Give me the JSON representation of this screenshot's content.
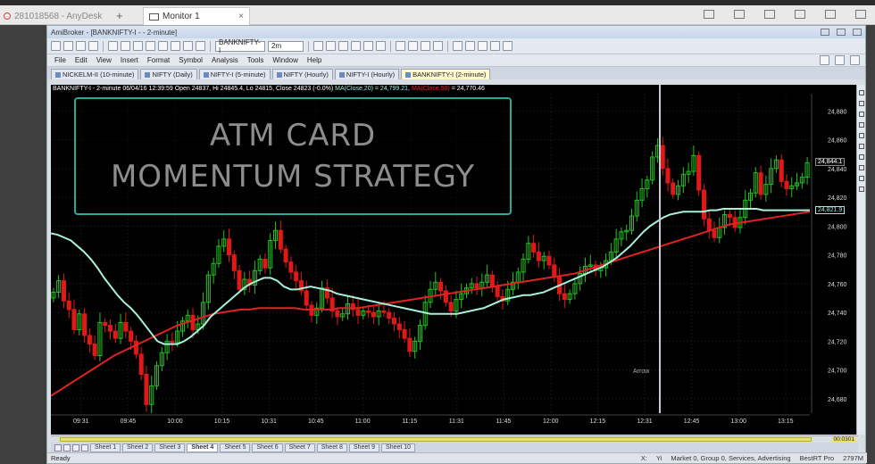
{
  "anydesk": {
    "session_tab": "281018568 - AnyDesk",
    "new_tab_symbol": "+",
    "monitor_tab": "Monitor 1",
    "close_symbol": "×"
  },
  "window": {
    "title": "AmiBroker - [BANKNIFTY-I - - 2-minute]"
  },
  "toolbar": {
    "symbol_combo": "BANKNIFTY-I",
    "interval_combo": "2m"
  },
  "menu": [
    "File",
    "Edit",
    "View",
    "Insert",
    "Format",
    "Symbol",
    "Analysis",
    "Tools",
    "Window",
    "Help"
  ],
  "chart_tabs": [
    {
      "label": "NICKELM-II (10-minute)",
      "active": false
    },
    {
      "label": "NIFTY (Daily)",
      "active": false
    },
    {
      "label": "NIFTY-I (5-minute)",
      "active": false
    },
    {
      "label": "NIFTY (Hourly)",
      "active": false
    },
    {
      "label": "NIFTY-I (Hourly)",
      "active": false
    },
    {
      "label": "BANKNIFTY-I (2-minute)",
      "active": true
    }
  ],
  "chart_header": {
    "main": "BANKNIFTY-I - 2-minute 06/04/16 12:39:59 Open 24837, Hi 24845.4, Lo 24815, Close 24823 (-0.0%)",
    "ma1": "MA(Close,20) = 24,799.21,",
    "ma2": "MA(Close,50)",
    "ma2_value": "= 24,770.46"
  },
  "overlay": {
    "line1": "ATM CARD",
    "line2": "MOMENTUM STRATEGY"
  },
  "price_tags": {
    "last": "24,844.1",
    "ma": "24,821.9"
  },
  "cursor_label": "Arrow",
  "chart_data": {
    "type": "candlestick",
    "title": "",
    "x_ticks": [
      "09:31",
      "09:45",
      "10:00",
      "10:15",
      "10:31",
      "10:45",
      "11:00",
      "11:15",
      "11:31",
      "11:45",
      "12:00",
      "12:15",
      "12:31",
      "12:45",
      "13:00",
      "13:15"
    ],
    "y_ticks": [
      24680,
      24700,
      24720,
      24740,
      24760,
      24780,
      24800,
      24820,
      24840,
      24860,
      24880
    ],
    "ylim": [
      24670,
      24892
    ],
    "grid": true,
    "colors": {
      "up": "#21c421",
      "down": "#e01818",
      "ma20": "#a8f0dc",
      "ma50": "#e02222",
      "background": "#000000"
    },
    "close": [
      24754,
      24762,
      24748,
      24742,
      24728,
      24739,
      24724,
      24718,
      24710,
      24733,
      24731,
      24727,
      24722,
      24733,
      24727,
      24720,
      24711,
      24697,
      24676,
      24689,
      24703,
      24712,
      24720,
      24719,
      24727,
      24734,
      24738,
      24728,
      24732,
      24747,
      24766,
      24774,
      24786,
      24791,
      24780,
      24769,
      24756,
      24763,
      24759,
      24769,
      24777,
      24771,
      24790,
      24797,
      24784,
      24775,
      24768,
      24762,
      24755,
      24745,
      24738,
      24743,
      24757,
      24750,
      24741,
      24737,
      24739,
      24746,
      24742,
      24738,
      24741,
      24740,
      24737,
      24741,
      24740,
      24736,
      24732,
      24728,
      24722,
      24713,
      24720,
      24731,
      24747,
      24756,
      24761,
      24755,
      24747,
      24741,
      24749,
      24753,
      24757,
      24760,
      24757,
      24761,
      24766,
      24758,
      24751,
      24748,
      24756,
      24761,
      24768,
      24777,
      24788,
      24782,
      24776,
      24779,
      24773,
      24765,
      24753,
      24749,
      24753,
      24760,
      24767,
      24772,
      24773,
      24769,
      24771,
      24776,
      24782,
      24791,
      24796,
      24797,
      24807,
      24818,
      24826,
      24832,
      24848,
      24856,
      24840,
      24830,
      24822,
      24828,
      24836,
      24838,
      24849,
      24825,
      24805,
      24797,
      24792,
      24799,
      24808,
      24806,
      24799,
      24806,
      24818,
      24823,
      24837,
      24822,
      24829,
      24840,
      24846,
      24831,
      24826,
      24828,
      24830,
      24834,
      24844
    ],
    "ma20": [
      24795,
      24794,
      24792,
      24790,
      24786,
      24782,
      24777,
      24771,
      24764,
      24758,
      24752,
      24747,
      24743,
      24738,
      24732,
      24726,
      24720,
      24718,
      24718,
      24718,
      24720,
      24723,
      24727,
      24731,
      24737,
      24741,
      24745,
      24749,
      24753,
      24757,
      24760,
      24762,
      24764,
      24764,
      24762,
      24758,
      24756,
      24756,
      24757,
      24758,
      24757,
      24756,
      24755,
      24753,
      24752,
      24751,
      24750,
      24749,
      24748,
      24747,
      24746,
      24745,
      24744,
      24743,
      24742,
      24741,
      24740,
      24739,
      24739,
      24739,
      24739,
      24739,
      24740,
      24741,
      24742,
      24743,
      24745,
      24747,
      24749,
      24750,
      24751,
      24752,
      24752,
      24753,
      24754,
      24756,
      24758,
      24760,
      24762,
      24764,
      24766,
      24768,
      24770,
      24772,
      24775,
      24778,
      24782,
      24786,
      24791,
      24796,
      24800,
      24803,
      24806,
      24808,
      24809,
      24810,
      24810,
      24810,
      24810,
      24811,
      24811,
      24812,
      24812,
      24812,
      24812,
      24812,
      24812,
      24811,
      24811,
      24811,
      24811,
      24811,
      24811,
      24811,
      24811
    ],
    "ma50": [
      24682,
      24686,
      24690,
      24694,
      24698,
      24702,
      24706,
      24710,
      24713,
      24716,
      24719,
      24722,
      24725,
      24728,
      24731,
      24733,
      24735,
      24737,
      24739,
      24740,
      24741,
      24742,
      24742,
      24743,
      24743,
      24743,
      24743,
      24743,
      24742,
      24742,
      24742,
      24742,
      24743,
      24743,
      24743,
      24744,
      24745,
      24746,
      24747,
      24748,
      24749,
      24750,
      24751,
      24752,
      24753,
      24754,
      24755,
      24756,
      24757,
      24758,
      24759,
      24760,
      24761,
      24762,
      24763,
      24764,
      24765,
      24766,
      24767,
      24769,
      24771,
      24773,
      24775,
      24777,
      24779,
      24781,
      24783,
      24785,
      24787,
      24789,
      24791,
      24793,
      24795,
      24797,
      24799,
      24801,
      24802,
      24803,
      24804,
      24805,
      24806,
      24807,
      24808,
      24809,
      24810
    ]
  },
  "sheets": {
    "items": [
      "Sheet 1",
      "Sheet 2",
      "Sheet 3",
      "Sheet 4",
      "Sheet 5",
      "Sheet 6",
      "Sheet 7",
      "Sheet 8",
      "Sheet 9",
      "Sheet 10"
    ],
    "active_index": 3
  },
  "scroll": {
    "zoom_label": "00:0301"
  },
  "status": {
    "left": "Ready",
    "xy": "X:",
    "yi": "Yi",
    "market": "Market 0, Group 0, Services, Advertising",
    "plugin": "BestRT Pro",
    "mem": "2797M"
  }
}
